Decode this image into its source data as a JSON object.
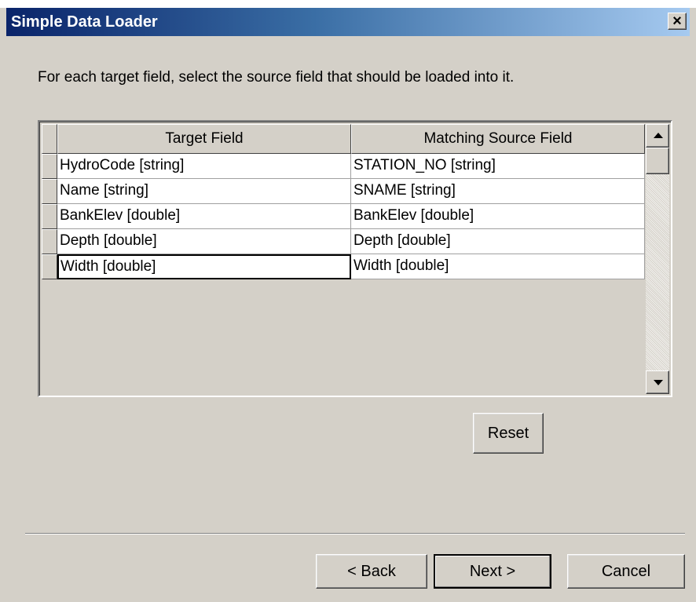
{
  "window": {
    "title": "Simple Data Loader",
    "close_label": "×"
  },
  "instructions": "For each target field, select the source field that should be loaded into it.",
  "grid": {
    "columns": [
      "Target Field",
      "Matching Source Field"
    ],
    "rows": [
      {
        "target": "HydroCode [string]",
        "source": "STATION_NO [string]"
      },
      {
        "target": "Name [string]",
        "source": "SNAME [string]"
      },
      {
        "target": "BankElev [double]",
        "source": "BankElev [double]"
      },
      {
        "target": "Depth [double]",
        "source": "Depth [double]"
      },
      {
        "target": "Width [double]",
        "source": "Width [double]"
      }
    ]
  },
  "buttons": {
    "reset": "Reset",
    "back": "< Back",
    "next": "Next >",
    "cancel": "Cancel"
  }
}
